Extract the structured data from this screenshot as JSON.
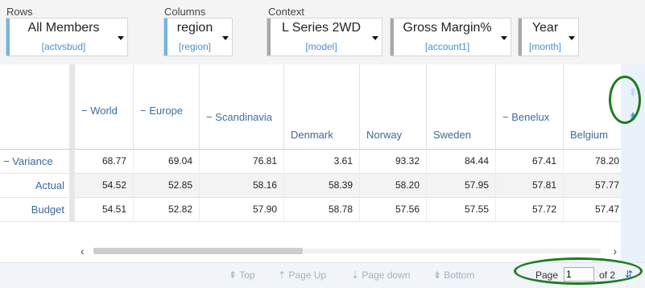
{
  "toolbar": {
    "rows_label": "Rows",
    "columns_label": "Columns",
    "context_label": "Context",
    "rows_dropdown": {
      "main": "All Members",
      "sub": "[actvsbud]"
    },
    "columns_dropdown": {
      "main": "region",
      "sub": "[region]"
    },
    "context_dropdowns": [
      {
        "main": "L Series 2WD",
        "sub": "[model]"
      },
      {
        "main": "Gross Margin%",
        "sub": "[account1]"
      },
      {
        "main": "Year",
        "sub": "[month]"
      }
    ]
  },
  "grid": {
    "columns": [
      "− World",
      "− Europe",
      "− Scandinavia",
      "Denmark",
      "Norway",
      "Sweden",
      "− Benelux",
      "Belgium"
    ],
    "rows": [
      {
        "label": "− Variance",
        "values": [
          "68.77",
          "69.04",
          "76.81",
          "3.61",
          "93.32",
          "84.44",
          "67.41",
          "78.20"
        ]
      },
      {
        "label": "Actual",
        "values": [
          "54.52",
          "52.85",
          "58.16",
          "58.39",
          "58.20",
          "57.95",
          "57.81",
          "57.77"
        ]
      },
      {
        "label": "Budget",
        "values": [
          "54.51",
          "52.82",
          "57.90",
          "58.78",
          "57.56",
          "57.55",
          "57.72",
          "57.47"
        ]
      }
    ]
  },
  "footer": {
    "top": "Top",
    "page_up": "Page Up",
    "page_down": "Page down",
    "bottom": "Bottom",
    "page_label": "Page",
    "page_value": "1",
    "page_of": "of 2"
  },
  "colors": {
    "accent_blue": "#6fb6e8",
    "highlight_green": "#1f7a1f",
    "link_blue": "#3a6fa0"
  }
}
